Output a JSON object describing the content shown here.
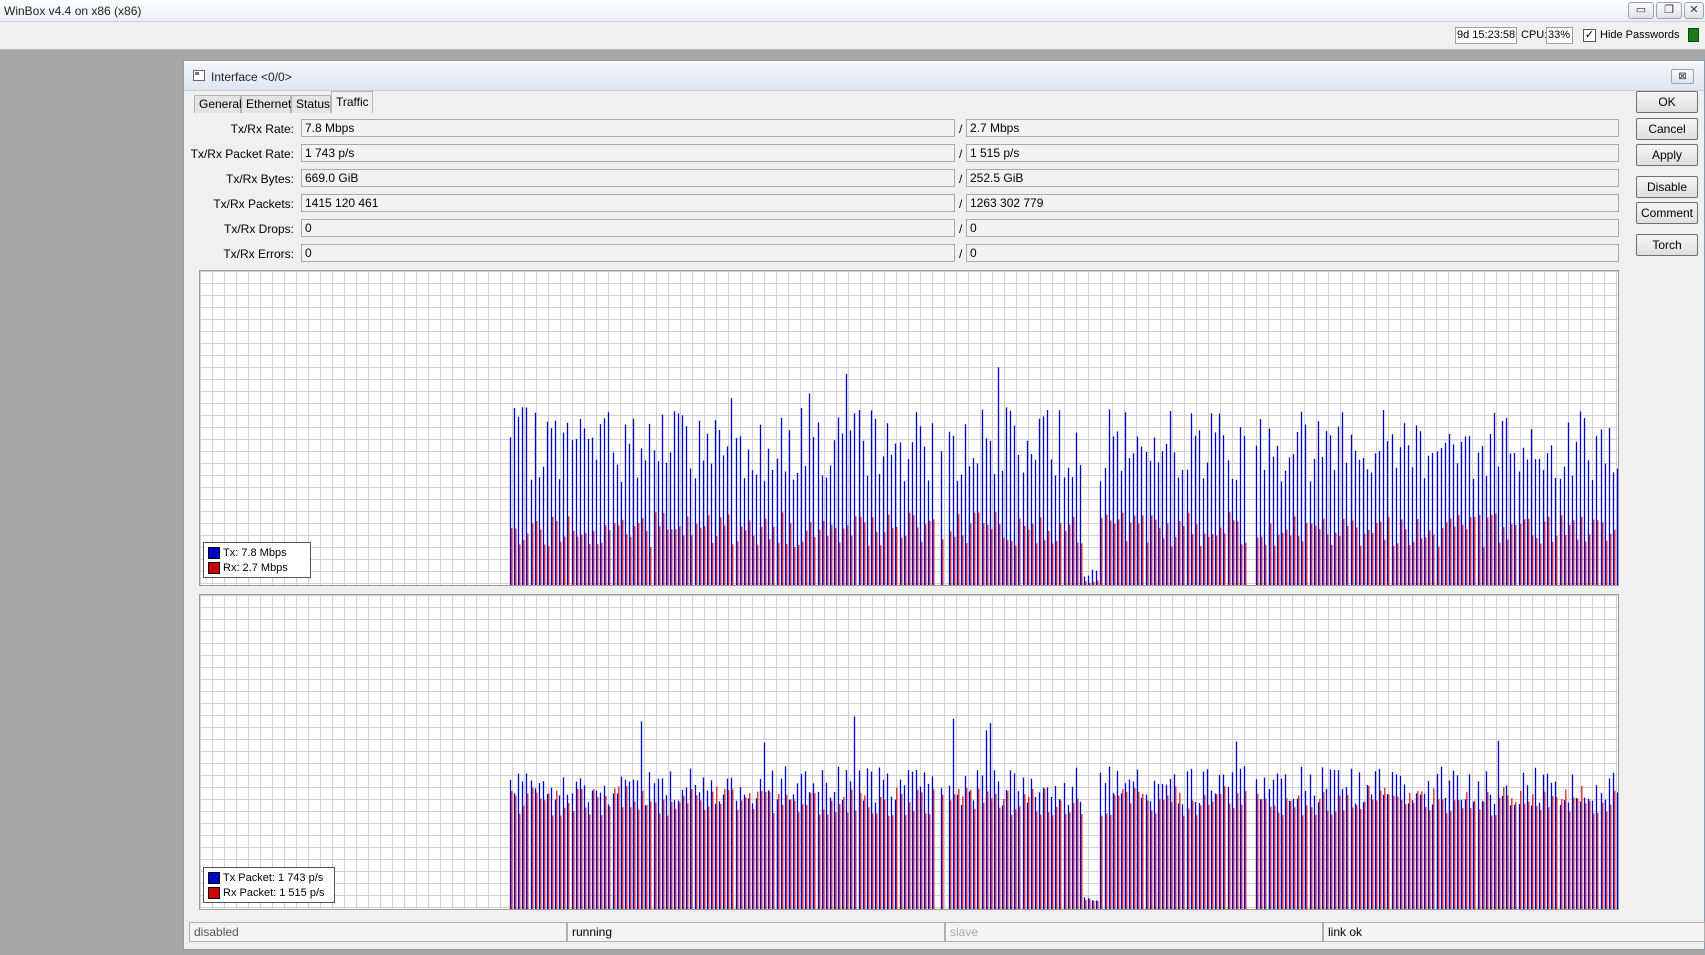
{
  "app": {
    "title": "WinBox v4.4 on x86 (x86)",
    "window_buttons": [
      "▭",
      "❐",
      "✕"
    ]
  },
  "toolbar": {
    "uptime": "9d 15:23:58",
    "cpu_label": "CPU:",
    "cpu_value": "33%",
    "hide_passwords_label": "Hide Passwords",
    "hide_passwords_checked": "✓"
  },
  "dialog": {
    "title": "Interface <0/0>",
    "close": "⊠",
    "tabs": [
      "General",
      "Ethernet",
      "Status",
      "Traffic"
    ],
    "active_tab": "Traffic",
    "rows": [
      {
        "label": "Tx/Rx Rate:",
        "tx": "7.8 Mbps",
        "rx": "2.7 Mbps"
      },
      {
        "label": "Tx/Rx Packet Rate:",
        "tx": "1 743 p/s",
        "rx": "1 515 p/s"
      },
      {
        "label": "Tx/Rx Bytes:",
        "tx": "669.0 GiB",
        "rx": "252.5 GiB"
      },
      {
        "label": "Tx/Rx Packets:",
        "tx": "1415 120 461",
        "rx": "1263 302 779"
      },
      {
        "label": "Tx/Rx Drops:",
        "tx": "0",
        "rx": "0"
      },
      {
        "label": "Tx/Rx Errors:",
        "tx": "0",
        "rx": "0"
      }
    ],
    "separator": "/",
    "buttons": [
      "OK",
      "Cancel",
      "Apply",
      "Disable",
      "Comment",
      "Torch"
    ],
    "status": [
      "disabled",
      "running",
      "slave",
      "link ok"
    ]
  },
  "colors": {
    "tx": "#0000cc",
    "rx": "#cc0000",
    "grid": "#d0d0d0"
  },
  "chart_data": [
    {
      "type": "bar",
      "legend": [
        {
          "label": "Tx:  7.8 Mbps",
          "color": "#0000cc"
        },
        {
          "label": "Rx:  2.7 Mbps",
          "color": "#cc0000"
        }
      ]
    },
    {
      "type": "bar",
      "legend": [
        {
          "label": "Tx Packet:  1 743 p/s",
          "color": "#0000cc"
        },
        {
          "label": "Rx Packet:  1 515 p/s",
          "color": "#cc0000"
        }
      ]
    }
  ]
}
